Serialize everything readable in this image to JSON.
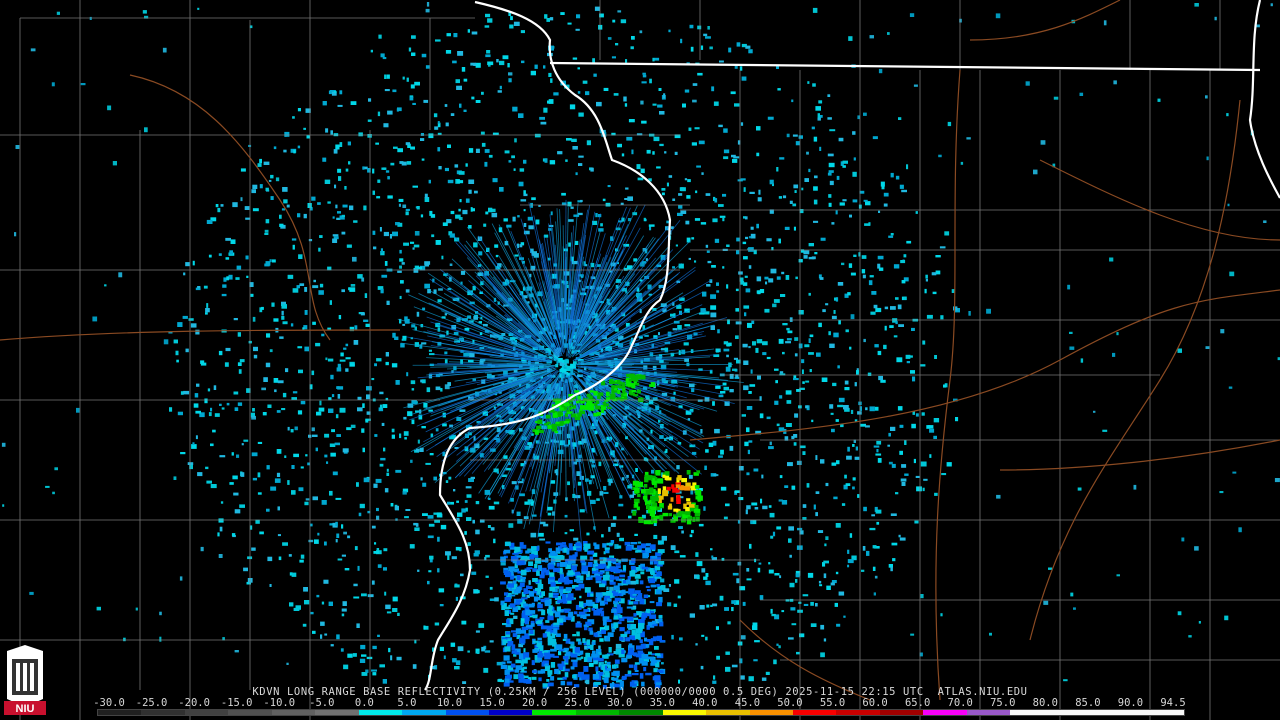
{
  "product_title": "KDVN LONG RANGE BASE REFLECTIVITY (0.25KM / 256 LEVEL) (000000/0000 0.5 DEG) 2025-11-15 22:15 UTC  ATLAS.NIU.EDU",
  "logo_text": "NIU",
  "scale": {
    "labels": [
      "-30.0",
      "-25.0",
      "-20.0",
      "-15.0",
      "-10.0",
      "-5.0",
      "0.0",
      "5.0",
      "10.0",
      "15.0",
      "20.0",
      "25.0",
      "30.0",
      "35.0",
      "40.0",
      "45.0",
      "50.0",
      "55.0",
      "60.0",
      "65.0",
      "70.0",
      "75.0",
      "80.0",
      "85.0",
      "90.0",
      "94.5"
    ],
    "colors": [
      "#202020",
      "#303030",
      "#404040",
      "#505050",
      "#606060",
      "#707070",
      "#00e8e8",
      "#00a8f0",
      "#0050f0",
      "#0000c8",
      "#00e800",
      "#00b800",
      "#008800",
      "#f8f800",
      "#e8c000",
      "#f89000",
      "#f80000",
      "#c80000",
      "#a00000",
      "#f800f8",
      "#9858c8",
      "#f8f8f8",
      "#f8f8f8",
      "#f8f8f8",
      "#f8f8f8"
    ]
  },
  "colors": {
    "state_border": "#ffffff",
    "county_lines": "#8a8a8a",
    "highways": "#8a4a22",
    "background": "#000000"
  },
  "radar_site": "KDVN"
}
